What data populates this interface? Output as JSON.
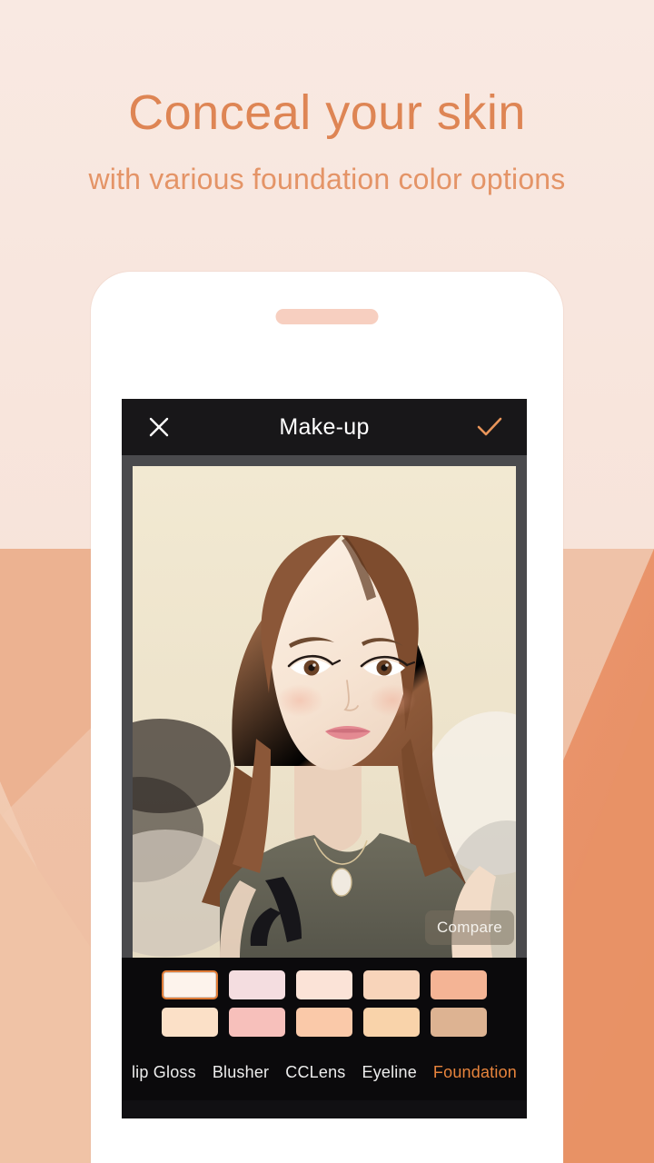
{
  "promo": {
    "title": "Conceal your skin",
    "subtitle": "with various foundation color options",
    "title_color": "#DE8554",
    "subtitle_color": "#E49467"
  },
  "background": {
    "top_color": "#F8E7DF",
    "mid_color": "#EFC0A6",
    "accent_color": "#E89B75",
    "deep_color": "#E89266"
  },
  "phone": {
    "body_color": "#FFFFFF",
    "speaker_color": "#F7CFC0"
  },
  "app": {
    "header": {
      "title": "Make-up",
      "close_icon": "close-x-icon",
      "confirm_icon": "check-icon",
      "close_color": "#FFFFFF",
      "confirm_color": "#E8955A",
      "bar_color": "#181719"
    },
    "photo": {
      "compare_label": "Compare",
      "frame_color": "#4A4A4D",
      "backdrop_color": "#EFE6CE"
    },
    "palette": {
      "selected_index": 0,
      "selection_color": "#E07B36",
      "rows": [
        [
          {
            "name": "swatch-porcelain",
            "color": "#FDF3EC"
          },
          {
            "name": "swatch-rose-ivory",
            "color": "#F4DDE0"
          },
          {
            "name": "swatch-soft-peach",
            "color": "#FBE3D7"
          },
          {
            "name": "swatch-warm-sand",
            "color": "#F8D4BA"
          },
          {
            "name": "swatch-apricot",
            "color": "#F4B495"
          }
        ],
        [
          {
            "name": "swatch-cream-beige",
            "color": "#FBE0C7"
          },
          {
            "name": "swatch-blush-pink",
            "color": "#F7C0BB"
          },
          {
            "name": "swatch-light-tan",
            "color": "#FAC9A9"
          },
          {
            "name": "swatch-golden-nude",
            "color": "#F9D3AA"
          },
          {
            "name": "swatch-deep-honey",
            "color": "#DDB392"
          }
        ]
      ]
    },
    "tabs": [
      {
        "label": "lip Gloss",
        "active": false
      },
      {
        "label": "Blusher",
        "active": false
      },
      {
        "label": "CCLens",
        "active": false
      },
      {
        "label": "Eyeline",
        "active": false
      },
      {
        "label": "Foundation",
        "active": true
      }
    ],
    "tab_active_color": "#E8843C",
    "tab_color": "#EDEDED"
  }
}
